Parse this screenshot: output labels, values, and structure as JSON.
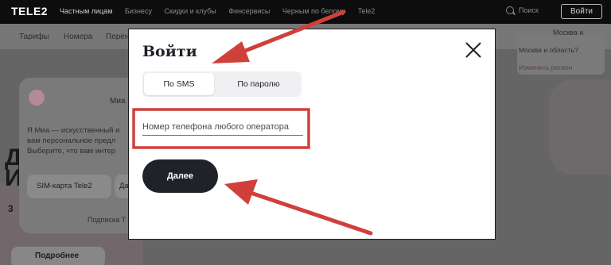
{
  "topbar": {
    "logo": "TELE2",
    "nav": [
      "Частным лицам",
      "Бизнесу",
      "Скидки и клубы",
      "Финсервисы",
      "Черным по белому",
      "Tele2"
    ],
    "active_index": 0,
    "search_label": "Поиск",
    "search_icon": "search-icon",
    "login_label": "Войти"
  },
  "subnav": {
    "items": [
      "Тарифы",
      "Номера",
      "Перен"
    ],
    "region_city": "Москва и"
  },
  "region_popup": {
    "question": "Москва и область?",
    "change_label": "Изменить регион"
  },
  "hero": {
    "letter_1": "Д",
    "letter_2": "И",
    "letter_3": "3"
  },
  "assistant_card": {
    "name": "Миа",
    "text_lines": [
      "Я Миа — искусственный и",
      "вам персональное предл",
      "Выберите, что вам интер"
    ],
    "chip_1": "SIM-карта Tele2",
    "chip_2": "Да",
    "subscription": "Подписка Т",
    "more_label": "Подробнее"
  },
  "modal": {
    "title": "Войти",
    "close_icon": "close-icon",
    "tabs": [
      "По SMS",
      "По паролю"
    ],
    "active_tab": 0,
    "phone_placeholder": "Номер телефона любого оператора",
    "phone_value": "",
    "next_label": "Далее"
  },
  "colors": {
    "annotation_red": "#d0403a",
    "dark_button": "#1f2229",
    "brand_pink": "#b38a97"
  }
}
